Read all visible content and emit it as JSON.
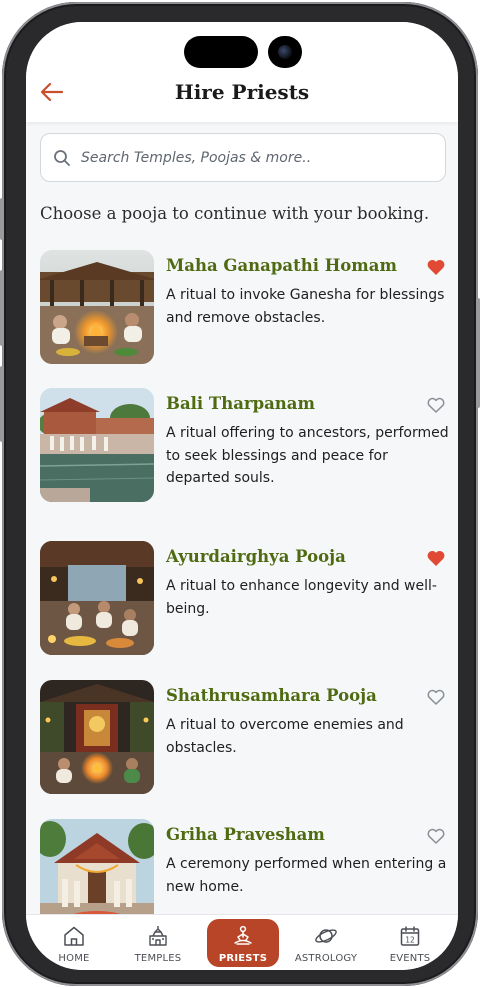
{
  "header": {
    "title": "Hire Priests",
    "back_icon": "arrow-left-icon"
  },
  "search": {
    "placeholder": "Search Temples, Poojas & more.."
  },
  "section_heading": "Choose a pooja to continue with your booking.",
  "colors": {
    "accent": "#b84527",
    "title_green": "#4f6b12",
    "favorite_filled": "#e04a34",
    "favorite_outline": "#8a8f96"
  },
  "poojas": [
    {
      "name": "Maha Ganapathi Homam",
      "description": "A ritual to invoke Ganesha for blessings and remove obstacles.",
      "favorite": true
    },
    {
      "name": "Bali Tharpanam",
      "description": "A ritual offering to ancestors, performed to seek blessings and peace for departed souls.",
      "favorite": false
    },
    {
      "name": "Ayurdairghya Pooja",
      "description": "A ritual to enhance longevity and well-being.",
      "favorite": true
    },
    {
      "name": "Shathrusamhara Pooja",
      "description": "A ritual to overcome enemies and obstacles.",
      "favorite": false
    },
    {
      "name": "Griha Pravesham",
      "description": "A ceremony performed when entering a new home.",
      "favorite": false
    }
  ],
  "nav": {
    "items": [
      {
        "label": "HOME",
        "icon": "home-icon"
      },
      {
        "label": "TEMPLES",
        "icon": "temple-icon"
      },
      {
        "label": "PRIESTS",
        "icon": "meditation-icon",
        "active": true
      },
      {
        "label": "ASTROLOGY",
        "icon": "planet-icon"
      },
      {
        "label": "EVENTS",
        "icon": "calendar-icon",
        "calendar_day": "12"
      }
    ]
  }
}
